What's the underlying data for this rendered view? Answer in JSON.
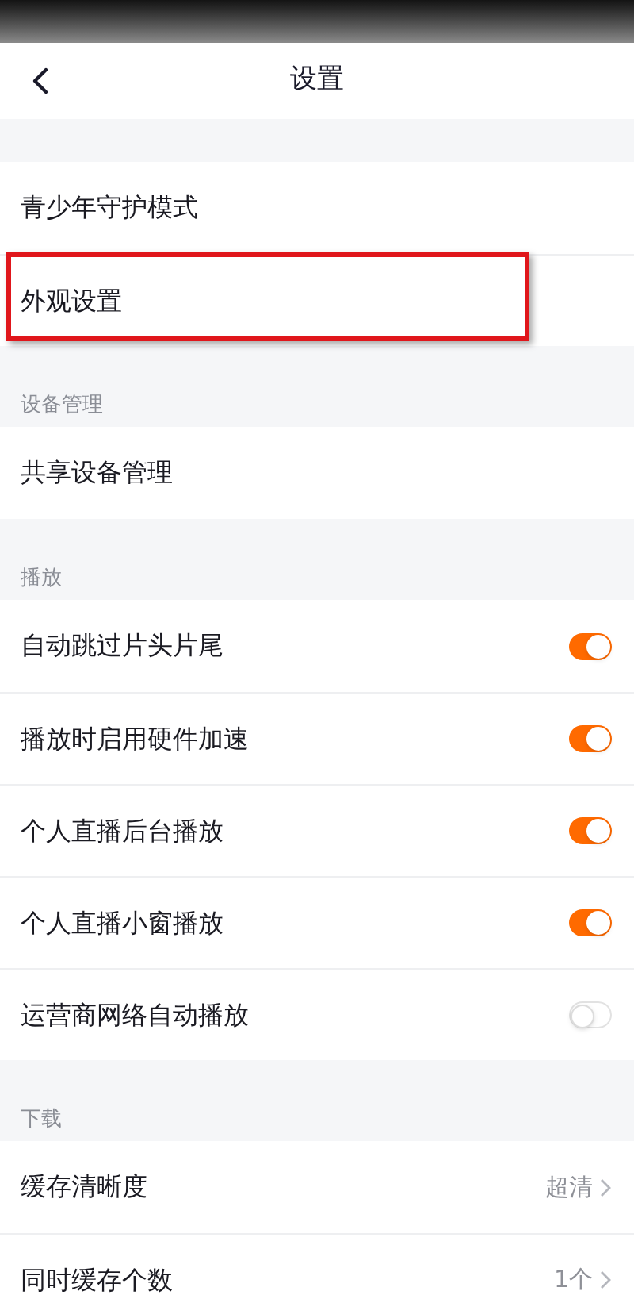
{
  "header": {
    "title": "设置"
  },
  "sections": [
    {
      "items": [
        {
          "kind": "link",
          "label": "青少年守护模式",
          "highlighted": false
        },
        {
          "kind": "link",
          "label": "外观设置",
          "highlighted": true
        }
      ]
    },
    {
      "title": "设备管理",
      "items": [
        {
          "kind": "link",
          "label": "共享设备管理",
          "highlighted": false
        }
      ]
    },
    {
      "title": "播放",
      "items": [
        {
          "kind": "toggle",
          "label": "自动跳过片头片尾",
          "on": true
        },
        {
          "kind": "toggle",
          "label": "播放时启用硬件加速",
          "on": true
        },
        {
          "kind": "toggle",
          "label": "个人直播后台播放",
          "on": true
        },
        {
          "kind": "toggle",
          "label": "个人直播小窗播放",
          "on": true
        },
        {
          "kind": "toggle",
          "label": "运营商网络自动播放",
          "on": false
        }
      ]
    },
    {
      "title": "下载",
      "items": [
        {
          "kind": "link",
          "label": "缓存清晰度",
          "value": "超清",
          "highlighted": false
        },
        {
          "kind": "link",
          "label": "同时缓存个数",
          "value": "1个",
          "highlighted": false
        }
      ]
    }
  ]
}
